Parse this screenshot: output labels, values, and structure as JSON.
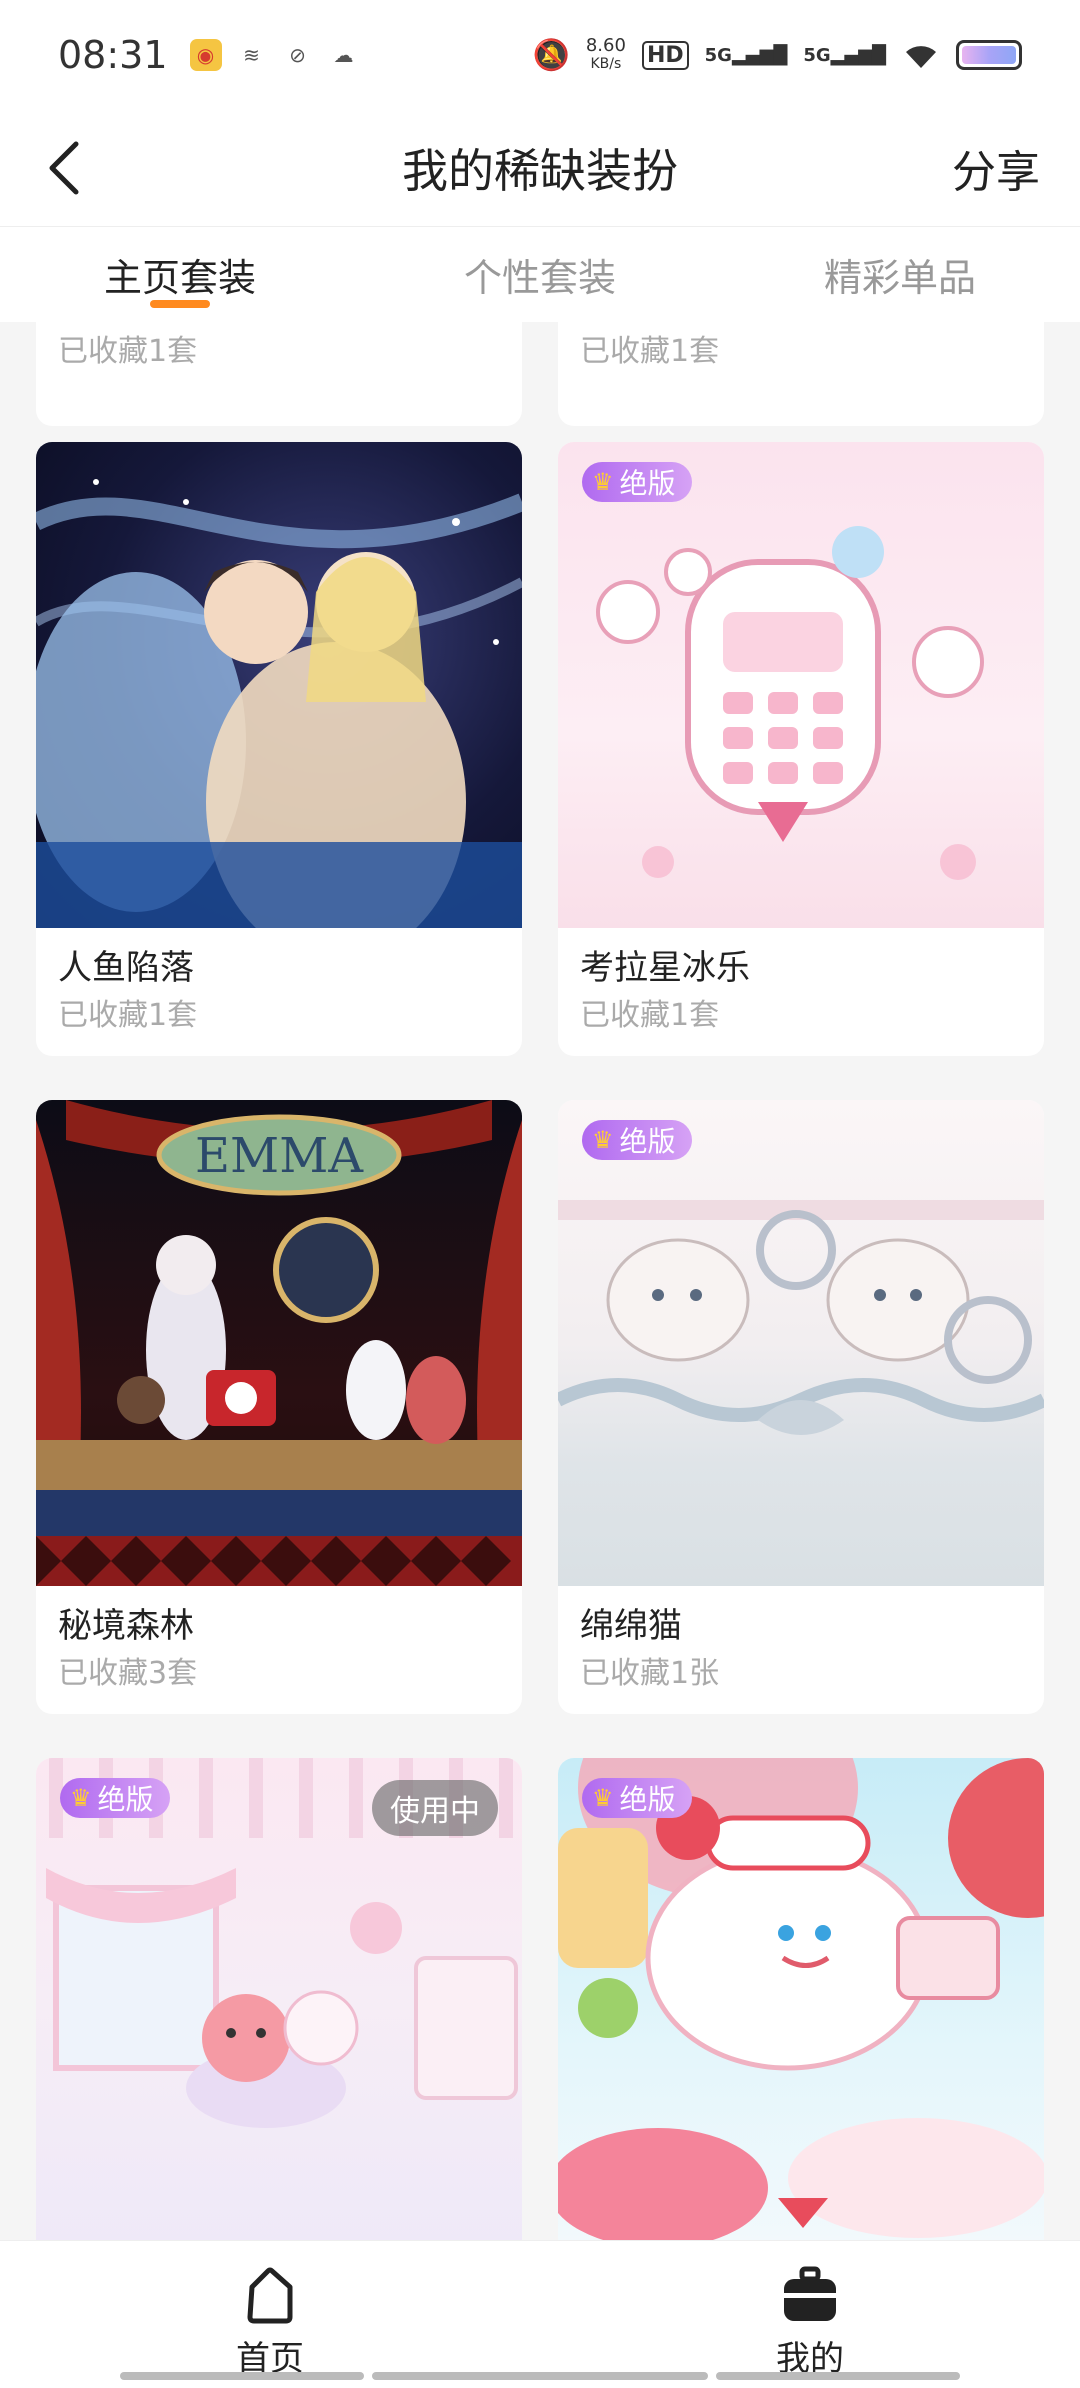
{
  "status_bar": {
    "time": "08:31",
    "speed": "8.60",
    "speed_unit": "KB/s",
    "hd": "HD",
    "sim1": "5G",
    "sim2": "5G"
  },
  "header": {
    "title": "我的稀缺装扮",
    "share_label": "分享"
  },
  "tabs": [
    {
      "label": "主页套装",
      "active": true
    },
    {
      "label": "个性套装",
      "active": false
    },
    {
      "label": "精彩单品",
      "active": false
    }
  ],
  "cards": [
    {
      "name": "",
      "count": "已收藏1套"
    },
    {
      "name": "",
      "count": "已收藏1套"
    },
    {
      "name": "人鱼陷落",
      "count": "已收藏1套"
    },
    {
      "name": "考拉星冰乐",
      "count": "已收藏1套",
      "badge": "绝版"
    },
    {
      "name": "秘境森林",
      "count": "已收藏3套",
      "poster_text": "EMMA"
    },
    {
      "name": "绵绵猫",
      "count": "已收藏1张",
      "badge": "绝版"
    },
    {
      "name": "",
      "count": "",
      "badge": "绝版",
      "status": "使用中"
    },
    {
      "name": "",
      "count": "",
      "badge": "绝版"
    }
  ],
  "bottom_nav": [
    {
      "label": "首页",
      "icon": "home-icon"
    },
    {
      "label": "我的",
      "icon": "bag-icon"
    }
  ],
  "colors": {
    "accent": "#ff8a1f",
    "badge_start": "#b06af0",
    "badge_end": "#d6a2f5"
  }
}
